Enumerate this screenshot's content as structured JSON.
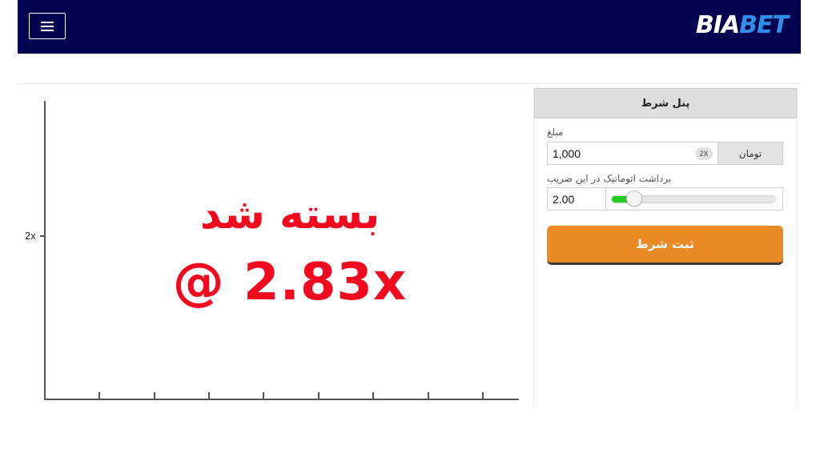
{
  "header": {
    "menu_icon": "hamburger-icon",
    "logo_part1": "BIA",
    "logo_part2": "BET",
    "background": "#03034f"
  },
  "graph": {
    "y_tick_label": "2x",
    "crash_title": "بسته شد",
    "crash_multiplier": "@ 2.83x",
    "crash_color": "#f2091f"
  },
  "bet_panel": {
    "title": "پنل شرط",
    "amount_label": "مبلغ",
    "amount_value": "1,000",
    "double_badge": "2X",
    "currency": "تومان",
    "auto_cashout_label": "برداشت اتوماتیک در این ضریب",
    "auto_cashout_value": "2.00",
    "auto_cashout_slider_fraction": 0.09,
    "place_bet_label": "ثبت شرط",
    "button_color": "#ea8a25"
  }
}
